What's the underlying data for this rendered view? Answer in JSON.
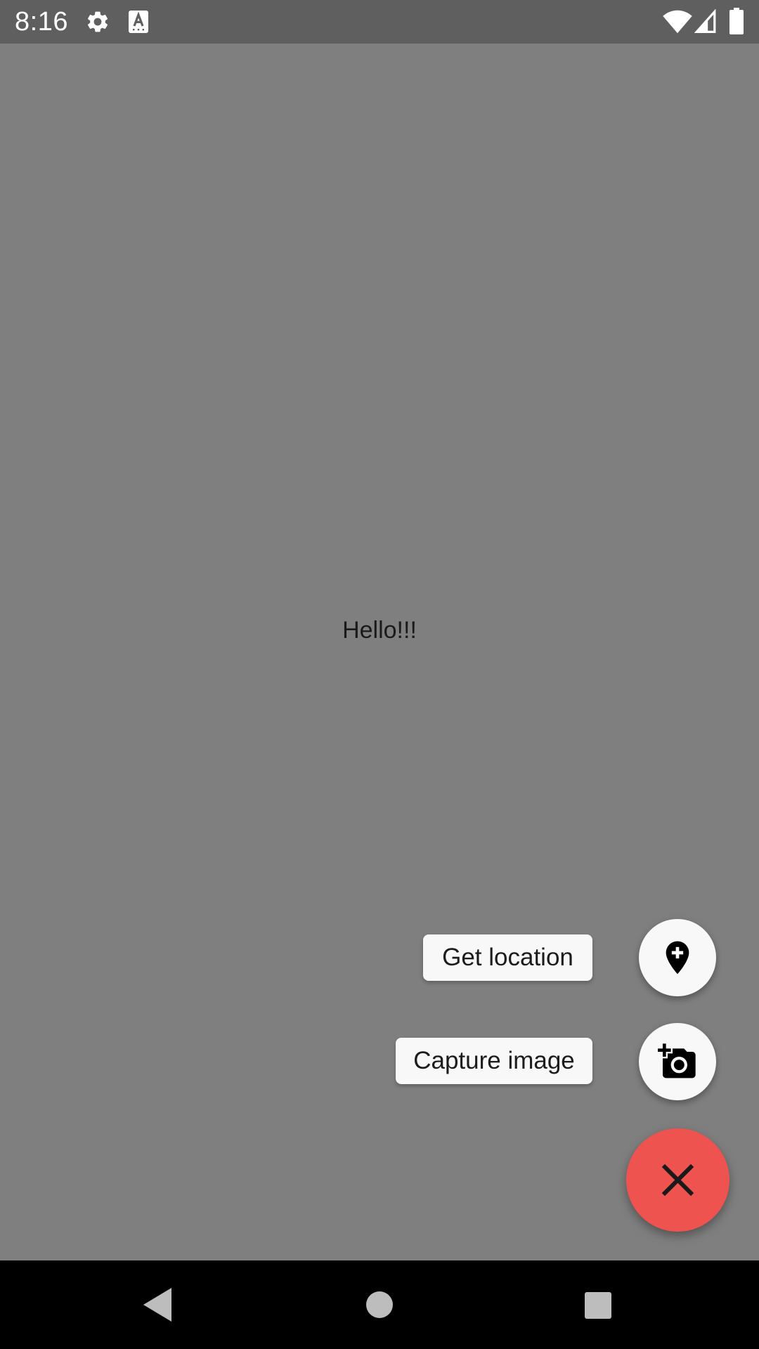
{
  "status_bar": {
    "time": "8:16",
    "icons": [
      "settings-icon",
      "a-icon",
      "wifi-icon",
      "signal-icon",
      "battery-icon"
    ]
  },
  "content": {
    "greeting": "Hello!!!"
  },
  "fab_menu": {
    "items": [
      {
        "label": "Get location",
        "icon": "add-location-icon"
      },
      {
        "label": "Capture image",
        "icon": "add-camera-icon"
      }
    ],
    "main_icon": "close-icon"
  },
  "navigation_bar": {
    "buttons": [
      "back-icon",
      "home-icon",
      "recents-icon"
    ]
  },
  "colors": {
    "scrim": "#7f7f7f",
    "status_bar": "#5f5f5f",
    "fab_main": "#ef5350",
    "mini_fab": "#f8f8f8",
    "nav_bar": "#000000"
  }
}
